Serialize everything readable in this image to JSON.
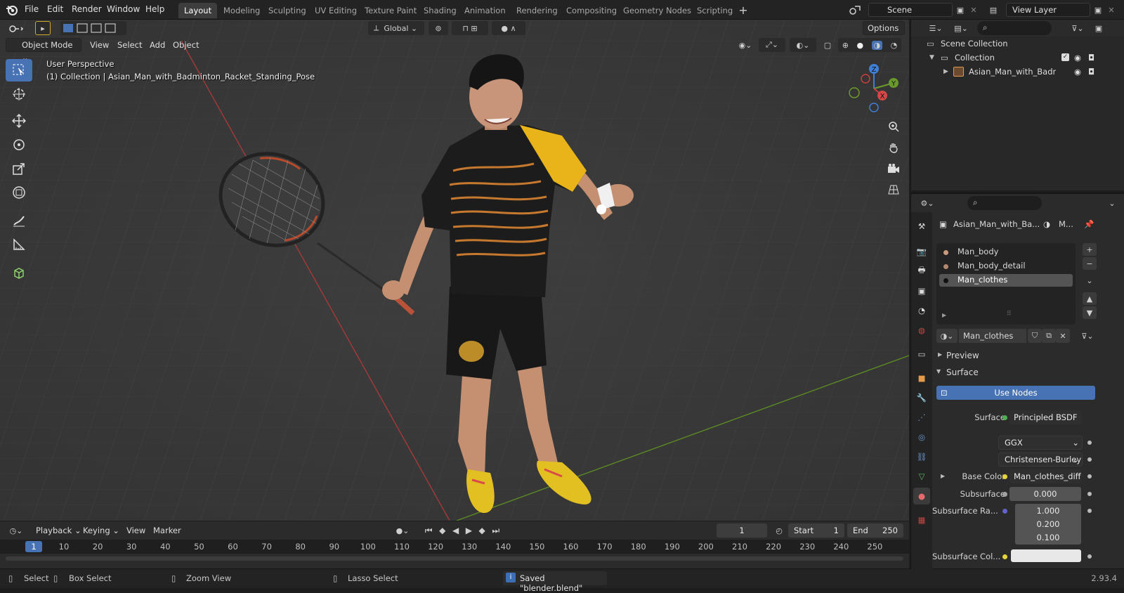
{
  "topbar": {
    "menus": [
      "File",
      "Edit",
      "Render",
      "Window",
      "Help"
    ],
    "workspaces": [
      "Layout",
      "Modeling",
      "Sculpting",
      "UV Editing",
      "Texture Paint",
      "Shading",
      "Animation",
      "Rendering",
      "Compositing",
      "Geometry Nodes",
      "Scripting"
    ],
    "active_workspace": "Layout",
    "scene": "Scene",
    "view_layer": "View Layer"
  },
  "viewport": {
    "mode": "Object Mode",
    "menus": [
      "View",
      "Select",
      "Add",
      "Object"
    ],
    "orientation": "Global",
    "options_label": "Options",
    "perspective_label": "User Perspective",
    "collection_label": "(1) Collection | Asian_Man_with_Badminton_Racket_Standing_Pose",
    "gizmo_axes": {
      "z": "Z",
      "y": "Y",
      "x": "X"
    },
    "colors": {
      "x_axis": "#c93f3f",
      "y_axis": "#6a9a2b",
      "z_axis": "#3f7fd5",
      "grid_bg": "#3a3a3a",
      "shirt_yellow": "#e8b419"
    }
  },
  "timeline": {
    "menus": [
      "Playback",
      "Keying",
      "View",
      "Marker"
    ],
    "current_frame": "1",
    "start_label": "Start",
    "start": "1",
    "end_label": "End",
    "end": "250",
    "ticks": [
      "1",
      "10",
      "20",
      "30",
      "40",
      "50",
      "60",
      "70",
      "80",
      "90",
      "100",
      "110",
      "120",
      "130",
      "140",
      "150",
      "160",
      "170",
      "180",
      "190",
      "200",
      "210",
      "220",
      "230",
      "240",
      "250"
    ]
  },
  "statusbar": {
    "select": "Select",
    "box_select": "Box Select",
    "zoom_view": "Zoom View",
    "lasso_select": "Lasso Select",
    "message": "Saved \"blender.blend\"",
    "version": "2.93.4"
  },
  "outliner": {
    "scene_collection": "Scene Collection",
    "collection": "Collection",
    "object": "Asian_Man_with_Badmin"
  },
  "properties": {
    "object_name": "Asian_Man_with_Ba...",
    "material_short": "M...",
    "slots": [
      "Man_body",
      "Man_body_detail",
      "Man_clothes"
    ],
    "selected_slot": "Man_clothes",
    "material_name": "Man_clothes",
    "preview_label": "Preview",
    "surface_label": "Surface",
    "use_nodes_label": "Use Nodes",
    "surface_field_label": "Surface",
    "surface_value": "Principled BSDF",
    "distribution": "GGX",
    "subsurface_method": "Christensen-Burley",
    "base_color_label": "Base Color",
    "base_color_value": "Man_clothes_diffus...",
    "subsurface_label": "Subsurface",
    "subsurface_value": "0.000",
    "subsurface_radius_label": "Subsurface Ra...",
    "subsurface_radius": [
      "1.000",
      "0.200",
      "0.100"
    ],
    "subsurface_color_label": "Subsurface Col...",
    "accent": "#4772b3"
  }
}
